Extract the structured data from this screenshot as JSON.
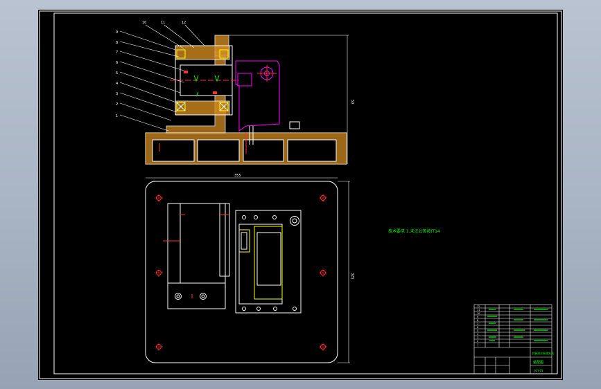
{
  "colors": {
    "background_top": "#b9c3d1",
    "sheet": "#000000",
    "line_white": "#ffffff",
    "line_yellow": "#ffff00",
    "line_green": "#00ff00",
    "line_magenta": "#ff00ff",
    "line_red": "#ff3030",
    "hatch_orange": "#d08a20"
  },
  "section_view": {
    "callouts": [
      "1",
      "2",
      "3",
      "4",
      "5",
      "6",
      "7",
      "8",
      "9",
      "10",
      "11",
      "12"
    ],
    "height_dimension": "50"
  },
  "plan_view": {
    "width_dimension": "355",
    "height_dimension": "325"
  },
  "technical_note": "技术要求  1.未注公差按IT14",
  "title_block": {
    "drawing_title": "封装测试系统夹具",
    "sheet_label": "装配图",
    "sheet_code": "JGY-01",
    "parts_rows": [
      "1",
      "2",
      "3",
      "4",
      "5",
      "6",
      "7",
      "8",
      "9",
      "10",
      "11",
      "12"
    ]
  }
}
